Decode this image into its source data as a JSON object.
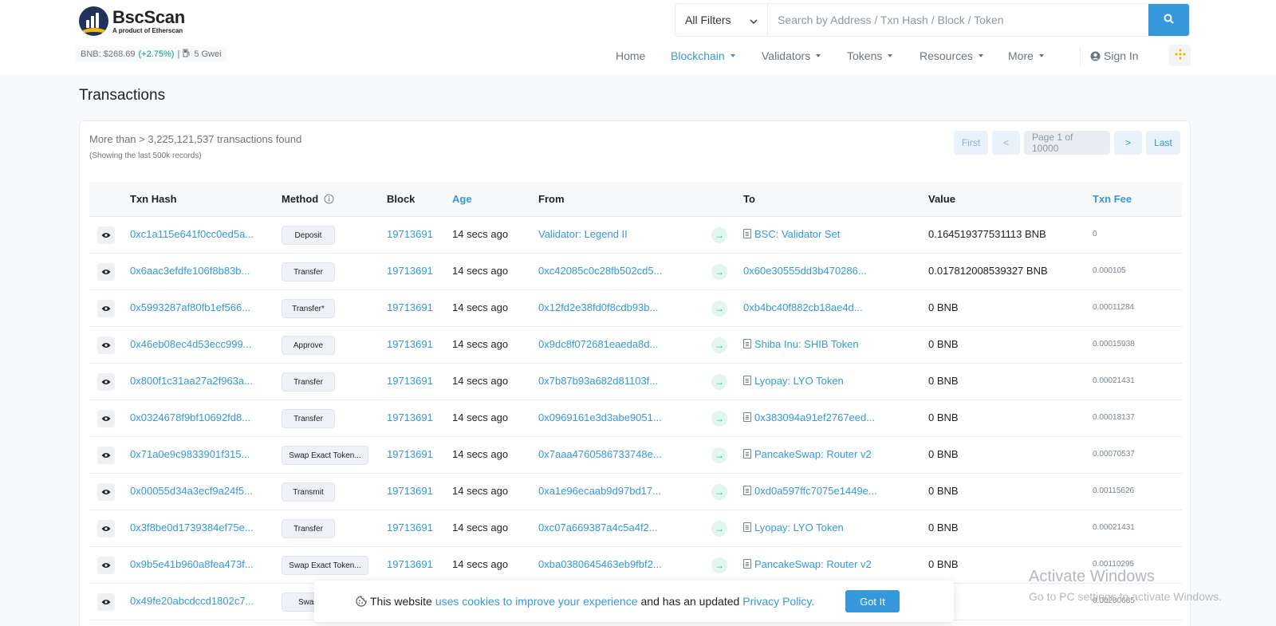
{
  "header": {
    "logo_title": "BscScan",
    "logo_subtitle": "A product of Etherscan",
    "bnb_price_label": "BNB: $268.69",
    "bnb_change": "(+2.75%)",
    "separator": "|",
    "gas": "5 Gwei"
  },
  "search": {
    "filter_label": "All Filters",
    "placeholder": "Search by Address / Txn Hash / Block / Token"
  },
  "nav": {
    "items": [
      "Home",
      "Blockchain",
      "Validators",
      "Tokens",
      "Resources",
      "More"
    ],
    "sign_in": "Sign In"
  },
  "page": {
    "title": "Transactions",
    "found_text": "More than > 3,225,121,537 transactions found",
    "found_sub": "(Showing the last 500k records)"
  },
  "pager": {
    "first": "First",
    "prev": "<",
    "page": "Page 1 of 10000",
    "next": ">",
    "last": "Last"
  },
  "table": {
    "headers": {
      "txn_hash": "Txn Hash",
      "method": "Method",
      "block": "Block",
      "age": "Age",
      "from": "From",
      "to": "To",
      "value": "Value",
      "txn_fee": "Txn Fee"
    },
    "rows": [
      {
        "hash": "0xc1a115e641f0cc0ed5a...",
        "method": "Deposit",
        "block": "19713691",
        "age": "14 secs ago",
        "from": "Validator: Legend II",
        "to": "BSC: Validator Set",
        "to_contract": true,
        "value": "0.164519377531113 BNB",
        "fee": "0"
      },
      {
        "hash": "0x6aac3efdfe106f8b83b...",
        "method": "Transfer",
        "block": "19713691",
        "age": "14 secs ago",
        "from": "0xc42085c0c28fb502cd5...",
        "to": "0x60e30555dd3b470286...",
        "to_contract": false,
        "value": "0.017812008539327 BNB",
        "fee": "0.000105"
      },
      {
        "hash": "0x5993287af80fb1ef566...",
        "method": "Transfer*",
        "block": "19713691",
        "age": "14 secs ago",
        "from": "0x12fd2e38fd0f8cdb93b...",
        "to": "0xb4bc40f882cb18ae4d...",
        "to_contract": false,
        "value": "0 BNB",
        "fee": "0.00011284"
      },
      {
        "hash": "0x46eb08ec4d53ecc999...",
        "method": "Approve",
        "block": "19713691",
        "age": "14 secs ago",
        "from": "0x9dc8f072681eaeda8d...",
        "to": "Shiba Inu: SHIB Token",
        "to_contract": true,
        "value": "0 BNB",
        "fee": "0.00015938"
      },
      {
        "hash": "0x800f1c31aa27a2f963a...",
        "method": "Transfer",
        "block": "19713691",
        "age": "14 secs ago",
        "from": "0x7b87b93a682d81103f...",
        "to": "Lyopay: LYO Token",
        "to_contract": true,
        "value": "0 BNB",
        "fee": "0.00021431"
      },
      {
        "hash": "0x0324678f9bf10692fd8...",
        "method": "Transfer",
        "block": "19713691",
        "age": "14 secs ago",
        "from": "0x0969161e3d3abe9051...",
        "to": "0x383094a91ef2767eed...",
        "to_contract": true,
        "value": "0 BNB",
        "fee": "0.00018137"
      },
      {
        "hash": "0x71a0e9c9833901f315...",
        "method": "Swap Exact Token...",
        "block": "19713691",
        "age": "14 secs ago",
        "from": "0x7aaa4760586733748e...",
        "to": "PancakeSwap: Router v2",
        "to_contract": true,
        "value": "0 BNB",
        "fee": "0.00070537"
      },
      {
        "hash": "0x00055d34a3ecf9a24f5...",
        "method": "Transmit",
        "block": "19713691",
        "age": "14 secs ago",
        "from": "0xa1e96ecaab9d97bd17...",
        "to": "0xd0a597ffc7075e1449e...",
        "to_contract": true,
        "value": "0 BNB",
        "fee": "0.00115626"
      },
      {
        "hash": "0x3f8be0d1739384ef75e...",
        "method": "Transfer",
        "block": "19713691",
        "age": "14 secs ago",
        "from": "0xc07a669387a4c5a4f2...",
        "to": "Lyopay: LYO Token",
        "to_contract": true,
        "value": "0 BNB",
        "fee": "0.00021431"
      },
      {
        "hash": "0x9b5e41b960a8fea473f...",
        "method": "Swap Exact Token...",
        "block": "19713691",
        "age": "14 secs ago",
        "from": "0xba0380645463eb9fbf2...",
        "to": "PancakeSwap: Router v2",
        "to_contract": true,
        "value": "0 BNB",
        "fee": "0.00110295"
      },
      {
        "hash": "0x49fe20abcdccd1802c7...",
        "method": "Swap",
        "block": "",
        "age": "",
        "from": "",
        "to": "",
        "to_contract": false,
        "value": "BNB",
        "fee": "0.00200685"
      }
    ]
  },
  "cookie": {
    "text_before": "This website",
    "link1": "uses cookies to improve your experience",
    "text_middle": "and has an updated",
    "link2": "Privacy Policy.",
    "button": "Got It"
  },
  "watermark": {
    "line1": "Activate Windows",
    "line2": "Go to PC settings to activate Windows."
  },
  "colors": {
    "accent": "#3498db",
    "brand_navy": "#21325b",
    "bnb_yellow": "#f0b90b",
    "positive": "#00a186"
  }
}
